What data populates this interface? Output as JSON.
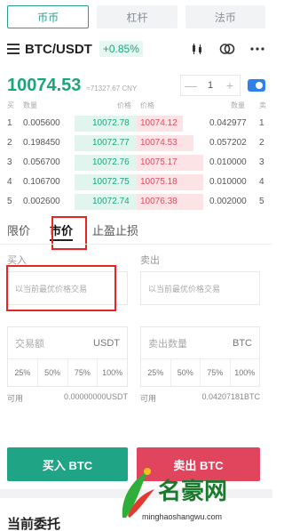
{
  "market_tabs": [
    "币币",
    "杠杆",
    "法币"
  ],
  "pair": {
    "name": "BTC/USDT",
    "change": "+0.85%"
  },
  "icons": [
    "menu-icon",
    "candlestick-icon",
    "compare-icon",
    "more-icon"
  ],
  "ticker": {
    "price": "10074.53",
    "cny": "≈71327.67 CNY"
  },
  "stepper": {
    "minus": "—",
    "value": "1",
    "plus": "+"
  },
  "book_headers": {
    "buy": "买",
    "qty": "数量",
    "bid_price": "价格",
    "ask_price": "价格",
    "ask_qty": "数量",
    "sell": "卖"
  },
  "book_rows": [
    {
      "idx": "1",
      "bid_qty": "0.005600",
      "bid_price": "10072.78",
      "ask_price": "10074.12",
      "ask_qty": "0.042977",
      "ask_idx": "1"
    },
    {
      "idx": "2",
      "bid_qty": "0.198450",
      "bid_price": "10072.77",
      "ask_price": "10074.53",
      "ask_qty": "0.057202",
      "ask_idx": "2"
    },
    {
      "idx": "3",
      "bid_qty": "0.056700",
      "bid_price": "10072.76",
      "ask_price": "10075.17",
      "ask_qty": "0.010000",
      "ask_idx": "3"
    },
    {
      "idx": "4",
      "bid_qty": "0.106700",
      "bid_price": "10072.75",
      "ask_price": "10075.18",
      "ask_qty": "0.010000",
      "ask_idx": "4"
    },
    {
      "idx": "5",
      "bid_qty": "0.002600",
      "bid_price": "10072.74",
      "ask_price": "10076.38",
      "ask_qty": "0.002000",
      "ask_idx": "5"
    }
  ],
  "order_tabs": [
    "限价",
    "市价",
    "止盈止损"
  ],
  "buy_col": {
    "label": "买入",
    "placeholder": "以当前最优价格交易",
    "amount_label": "交易额",
    "unit": "USDT",
    "avail_label": "可用",
    "avail_value": "0.00000000USDT",
    "button": "买入 BTC"
  },
  "sell_col": {
    "label": "卖出",
    "placeholder": "以当前最优价格交易",
    "amount_label": "卖出数量",
    "unit": "BTC",
    "avail_label": "可用",
    "avail_value": "0.04207181BTC",
    "button": "卖出 BTC"
  },
  "percents": [
    "25%",
    "50%",
    "75%",
    "100%"
  ],
  "orders_title": "当前委托",
  "watermark": {
    "name": "名豪网",
    "url": "minghaoshangwu.com"
  },
  "colors": {
    "green": "#1aa67c",
    "red": "#e04b5f",
    "annotation": "#e8261f"
  }
}
